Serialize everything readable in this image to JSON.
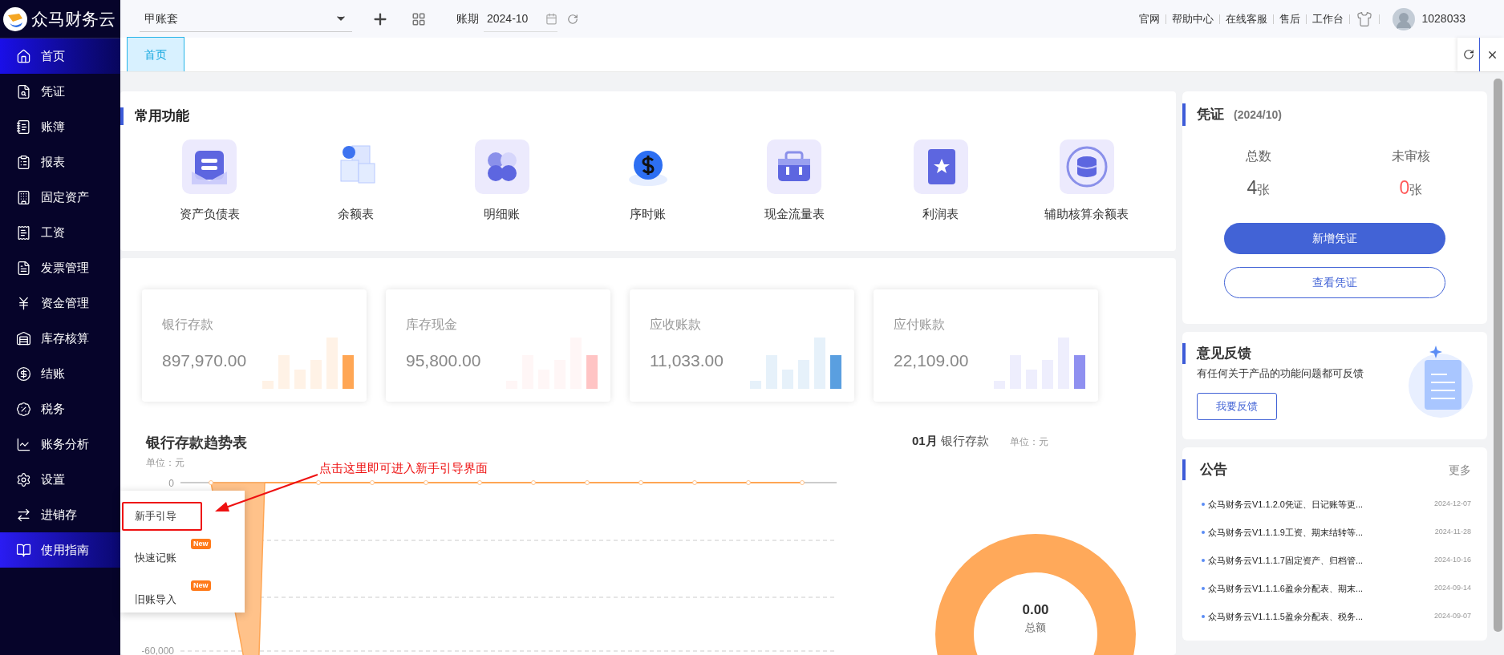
{
  "app": {
    "name": "众马财务云"
  },
  "sidebar": {
    "items": [
      {
        "label": "首页",
        "selected": true,
        "expanded": false
      },
      {
        "label": "凭证",
        "selected": false,
        "expanded": false
      },
      {
        "label": "账簿",
        "selected": false,
        "expanded": false
      },
      {
        "label": "报表",
        "selected": false,
        "expanded": false
      },
      {
        "label": "固定资产",
        "selected": false,
        "expanded": false
      },
      {
        "label": "工资",
        "selected": false,
        "expanded": false
      },
      {
        "label": "发票管理",
        "selected": false,
        "expanded": false
      },
      {
        "label": "资金管理",
        "selected": false,
        "expanded": false
      },
      {
        "label": "库存核算",
        "selected": false,
        "expanded": false
      },
      {
        "label": "结账",
        "selected": false,
        "expanded": false
      },
      {
        "label": "税务",
        "selected": false,
        "expanded": false
      },
      {
        "label": "账务分析",
        "selected": false,
        "expanded": false
      },
      {
        "label": "设置",
        "selected": false,
        "expanded": false
      },
      {
        "label": "进销存",
        "selected": false,
        "expanded": false
      },
      {
        "label": "使用指南",
        "selected": false,
        "expanded": true
      }
    ]
  },
  "top_bar": {
    "account": {
      "value": "甲账套"
    },
    "period": {
      "label": "账期",
      "value": "2024-10"
    },
    "links": [
      "官网",
      "帮助中心",
      "在线客服",
      "售后",
      "工作台"
    ],
    "user": {
      "name": "1028033"
    }
  },
  "tabs": [
    {
      "label": "首页",
      "selected": true
    }
  ],
  "common_functions": {
    "title": "常用功能",
    "items": [
      "资产负债表",
      "余额表",
      "明细账",
      "序时账",
      "现金流量表",
      "利润表",
      "辅助核算余额表"
    ]
  },
  "stat_cards": [
    {
      "label": "银行存款",
      "value": "897,970.00",
      "color": "#ffa654"
    },
    {
      "label": "库存现金",
      "value": "95,800.00",
      "color": "#ffc4c4"
    },
    {
      "label": "应收账款",
      "value": "11,033.00",
      "color": "#5a9fe0"
    },
    {
      "label": "应付账款",
      "value": "22,109.00",
      "color": "#8f90f0"
    }
  ],
  "trend_chart": {
    "title": "银行存款趋势表",
    "unit": "单位：元",
    "y_tick_labels": [
      "0",
      "-60,000"
    ]
  },
  "donut": {
    "month": "01月",
    "title": "银行存款",
    "unit": "单位：元",
    "total": "0.00",
    "total_label": "总额"
  },
  "guide_menu": {
    "items": [
      {
        "label": "新手引导",
        "highlighted": true
      },
      {
        "label": "快速记账",
        "badge": "New",
        "highlighted": false
      },
      {
        "label": "旧账导入",
        "badge": "New",
        "highlighted": false
      }
    ]
  },
  "annotation": {
    "text": "点击这里即可进入新手引导界面"
  },
  "voucher_panel": {
    "title": "凭证",
    "period": "(2024/10)",
    "total_label": "总数",
    "total": "4",
    "total_unit": "张",
    "unreviewed_label": "未审核",
    "unreviewed": "0",
    "unreviewed_unit": "张",
    "buttons": [
      "新增凭证",
      "查看凭证"
    ]
  },
  "feedback": {
    "title": "意见反馈",
    "text": "有任何关于产品的功能问题都可反馈",
    "button": "我要反馈"
  },
  "notices": {
    "title": "公告",
    "more": "更多",
    "items": [
      {
        "title": "众马财务云V1.1.2.0凭证、日记账等更...",
        "date": "2024-12-07"
      },
      {
        "title": "众马财务云V1.1.1.9工资、期末结转等...",
        "date": "2024-11-28"
      },
      {
        "title": "众马财务云V1.1.1.7固定资产、归档管...",
        "date": "2024-10-16"
      },
      {
        "title": "众马财务云V1.1.1.6盈余分配表、期末...",
        "date": "2024-09-14"
      },
      {
        "title": "众马财务云V1.1.1.5盈余分配表、税务...",
        "date": "2024-09-07"
      }
    ]
  }
}
